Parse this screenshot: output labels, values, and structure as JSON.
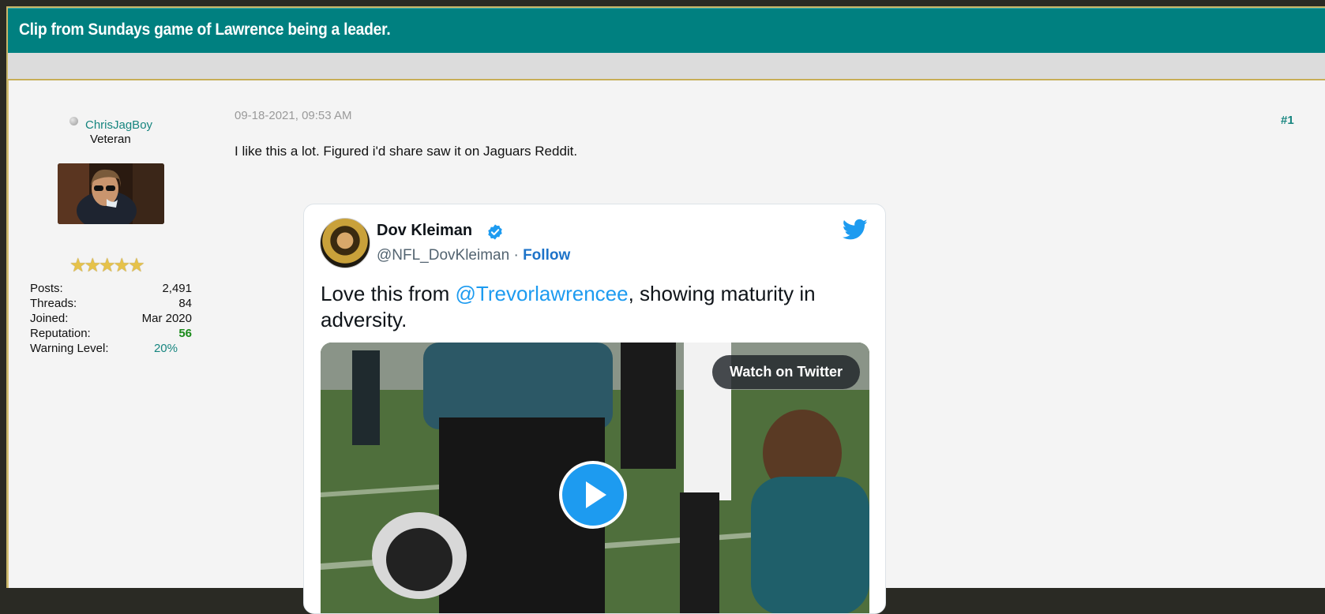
{
  "thread": {
    "title": "Clip from Sundays game of Lawrence being a leader."
  },
  "user": {
    "name": "ChrisJagBoy",
    "title": "Veteran",
    "stars": "★★★★★",
    "stats": [
      {
        "label": "Posts:",
        "value": "2,491"
      },
      {
        "label": "Threads:",
        "value": "84"
      },
      {
        "label": "Joined:",
        "value": "Mar 2020"
      },
      {
        "label": "Reputation:",
        "value": "56"
      },
      {
        "label": "Warning Level:",
        "value": "20%"
      }
    ]
  },
  "post": {
    "date": "09-18-2021, 09:53 AM",
    "number": "#1",
    "text": "I like this a lot. Figured i'd share saw it on Jaguars Reddit."
  },
  "tweet": {
    "author_name": "Dov Kleiman",
    "handle": "@NFL_DovKleiman",
    "separator": "·",
    "follow_label": "Follow",
    "text_before": "Love this from ",
    "mention": "@Trevorlawrencee",
    "text_after": ", showing maturity in adversity.",
    "watch_label": "Watch on Twitter"
  },
  "colors": {
    "header_bg": "#008080",
    "link": "#16857f",
    "twitter_blue": "#1d9bf0",
    "reputation": "#1a8a1a"
  },
  "icons": {
    "status": "offline-dot-icon",
    "verified": "verified-badge-icon",
    "twitter": "twitter-bird-icon",
    "play": "play-icon"
  }
}
